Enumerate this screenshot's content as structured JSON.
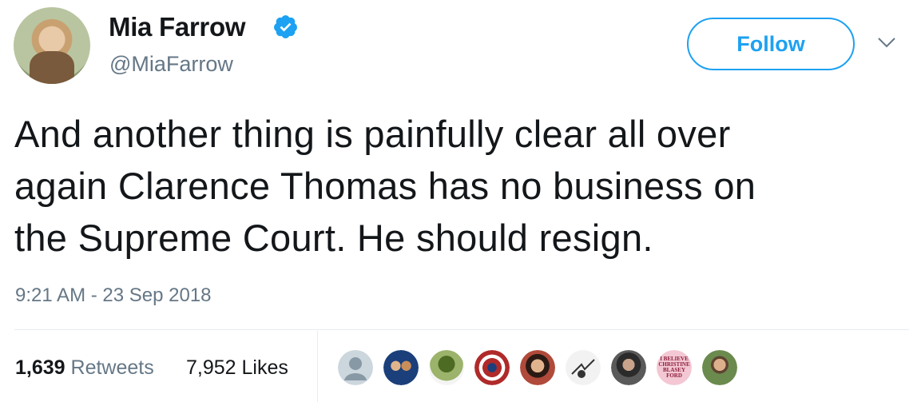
{
  "tweet": {
    "display_name": "Mia Farrow",
    "handle": "@MiaFarrow",
    "verified": true,
    "follow_label": "Follow",
    "text_lines": [
      "And another thing is painfully clear all over",
      "again Clarence Thomas has no business on",
      "the Supreme Court. He should resign."
    ],
    "timestamp": "9:21 AM - 23 Sep 2018",
    "retweets": {
      "count": "1,639",
      "label": "Retweets"
    },
    "likes": {
      "count": "7,952",
      "label": "Likes"
    },
    "likers": [
      {
        "icon": "default-avatar-icon",
        "color": "#ccd6dd"
      },
      {
        "icon": "liker-avatar-group",
        "color": "#1b3f7a"
      },
      {
        "icon": "liker-avatar-plant",
        "color": "#6f8f3a"
      },
      {
        "icon": "liker-avatar-shield",
        "color": "#b02a2a"
      },
      {
        "icon": "liker-avatar-woman",
        "color": "#8b5a3c"
      },
      {
        "icon": "liker-avatar-drawing",
        "color": "#f2f2f2"
      },
      {
        "icon": "liker-avatar-man-dark",
        "color": "#3a3a3a"
      },
      {
        "icon": "liker-avatar-badge",
        "color": "#f3c7d3",
        "text": "I BELIEVE CHRISTINE BLASEY FORD"
      },
      {
        "icon": "liker-avatar-man",
        "color": "#6b8a4e"
      }
    ]
  },
  "colors": {
    "brand_blue": "#1da1f2",
    "secondary_text": "#657786",
    "primary_text": "#14171a"
  }
}
